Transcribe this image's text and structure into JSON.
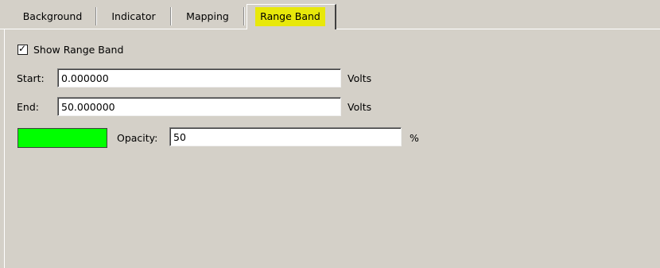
{
  "tabs": [
    {
      "label": "Background"
    },
    {
      "label": "Indicator"
    },
    {
      "label": "Mapping"
    },
    {
      "label": "Range Band",
      "active": true
    }
  ],
  "range_band": {
    "show_label": "Show Range Band",
    "show_checked": true,
    "start_label": "Start:",
    "start_value": "0.000000",
    "start_unit": "Volts",
    "end_label": "End:",
    "end_value": "50.000000",
    "end_unit": "Volts",
    "color": "#00ff00",
    "opacity_label": "Opacity:",
    "opacity_value": "50",
    "opacity_unit": "%"
  },
  "colors": {
    "panel_bg": "#d4d0c8",
    "active_tab_highlight": "#e8e80a"
  }
}
